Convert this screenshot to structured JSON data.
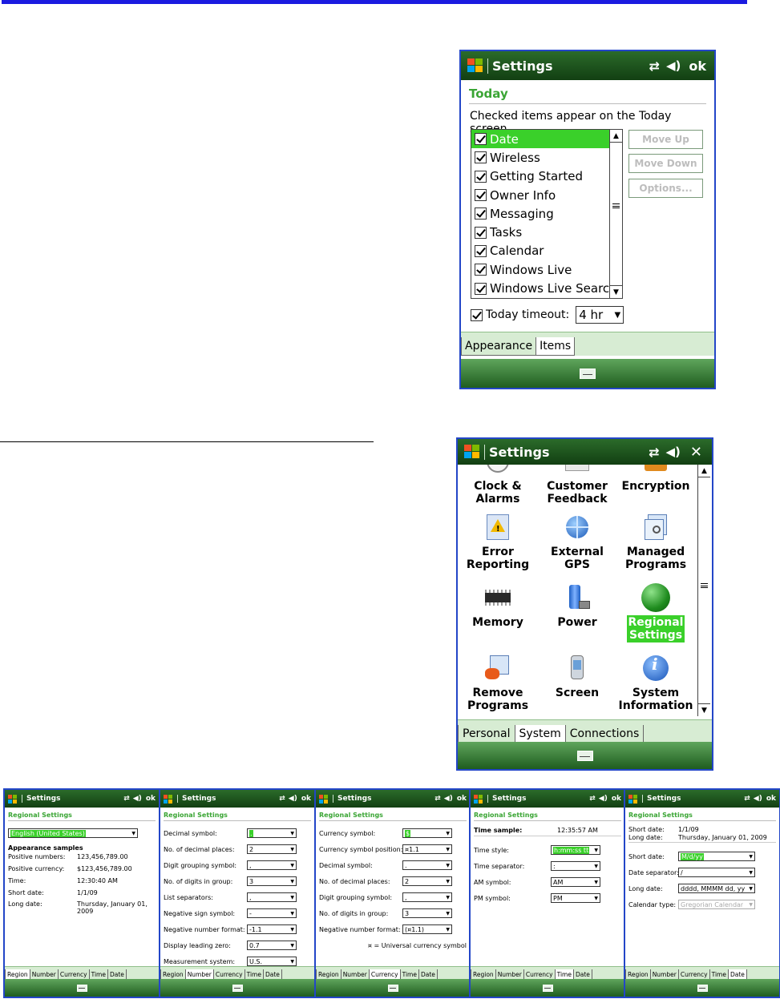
{
  "today_window": {
    "title": "Settings",
    "ok": "ok",
    "section": "Today",
    "intro": "Checked items appear on the Today screen.",
    "items": [
      "Date",
      "Wireless",
      "Getting Started",
      "Owner Info",
      "Messaging",
      "Tasks",
      "Calendar",
      "Windows Live",
      "Windows Live Search"
    ],
    "selected_item": "Date",
    "buttons": {
      "move_up": "Move Up",
      "move_down": "Move Down",
      "options": "Options..."
    },
    "timeout_label": "Today timeout:",
    "timeout_value": "4 hr",
    "tabs": [
      "Appearance",
      "Items"
    ],
    "active_tab": "Items"
  },
  "system_window": {
    "title": "Settings",
    "items": [
      {
        "l1": "Clock &",
        "l2": "Alarms",
        "icon": "clock-icon"
      },
      {
        "l1": "Customer",
        "l2": "Feedback",
        "icon": "feedback-icon"
      },
      {
        "l1": "Encryption",
        "l2": "",
        "icon": "encryption-icon"
      },
      {
        "l1": "Error",
        "l2": "Reporting",
        "icon": "error-reporting-icon"
      },
      {
        "l1": "External",
        "l2": "GPS",
        "icon": "gps-icon"
      },
      {
        "l1": "Managed",
        "l2": "Programs",
        "icon": "managed-programs-icon"
      },
      {
        "l1": "Memory",
        "l2": "",
        "icon": "memory-chip-icon"
      },
      {
        "l1": "Power",
        "l2": "",
        "icon": "battery-icon"
      },
      {
        "l1": "Regional",
        "l2": "Settings",
        "icon": "globe-icon"
      },
      {
        "l1": "Remove",
        "l2": "Programs",
        "icon": "remove-programs-icon"
      },
      {
        "l1": "Screen",
        "l2": "",
        "icon": "screen-stylus-icon"
      },
      {
        "l1": "System",
        "l2": "Information",
        "icon": "info-icon"
      }
    ],
    "selected_item": "Regional Settings",
    "tabs": [
      "Personal",
      "System",
      "Connections"
    ],
    "active_tab": "System"
  },
  "regional": {
    "title": "Settings",
    "ok": "ok",
    "section": "Regional Settings",
    "tabs": [
      "Region",
      "Number",
      "Currency",
      "Time",
      "Date"
    ],
    "region": {
      "locale": "English (United States)",
      "samples_heading": "Appearance samples",
      "rows": [
        {
          "k": "Positive numbers:",
          "v": "123,456,789.00"
        },
        {
          "k": "Positive currency:",
          "v": "$123,456,789.00"
        },
        {
          "k": "Time:",
          "v": "12:30:40 AM"
        },
        {
          "k": "Short date:",
          "v": "1/1/09"
        },
        {
          "k": "Long date:",
          "v": "Thursday, January 01, 2009"
        }
      ]
    },
    "number": {
      "rows": [
        {
          "k": "Decimal symbol:",
          "v": "."
        },
        {
          "k": "No. of decimal places:",
          "v": "2"
        },
        {
          "k": "Digit grouping symbol:",
          "v": ","
        },
        {
          "k": "No. of digits in group:",
          "v": "3"
        },
        {
          "k": "List separators:",
          "v": ","
        },
        {
          "k": "Negative sign symbol:",
          "v": "-"
        },
        {
          "k": "Negative number format:",
          "v": "-1.1"
        },
        {
          "k": "Display leading zero:",
          "v": "0.7"
        },
        {
          "k": "Measurement system:",
          "v": "U.S."
        }
      ]
    },
    "currency": {
      "rows": [
        {
          "k": "Currency symbol:",
          "v": "$"
        },
        {
          "k": "Currency symbol position:",
          "v": "¤1.1"
        },
        {
          "k": "Decimal symbol:",
          "v": "."
        },
        {
          "k": "No. of decimal places:",
          "v": "2"
        },
        {
          "k": "Digit grouping symbol:",
          "v": ","
        },
        {
          "k": "No. of digits in group:",
          "v": "3"
        },
        {
          "k": "Negative number format:",
          "v": "(¤1.1)"
        }
      ],
      "note": "¤ = Universal currency symbol"
    },
    "time": {
      "sample_label": "Time sample:",
      "sample_value": "12:35:57 AM",
      "rows": [
        {
          "k": "Time style:",
          "v": "h:mm:ss tt"
        },
        {
          "k": "Time separator:",
          "v": ":"
        },
        {
          "k": "AM symbol:",
          "v": "AM"
        },
        {
          "k": "PM symbol:",
          "v": "PM"
        }
      ]
    },
    "date": {
      "short_label": "Short date:",
      "short_value": "1/1/09",
      "long_label": "Long date:",
      "long_value": "Thursday, January 01, 2009",
      "rows": [
        {
          "k": "Short date:",
          "v": "M/d/yy"
        },
        {
          "k": "Date separator:",
          "v": "/"
        },
        {
          "k": "Long date:",
          "v": "dddd, MMMM dd, yy"
        },
        {
          "k": "Calendar type:",
          "v": "Gregorian Calendar"
        }
      ]
    }
  }
}
